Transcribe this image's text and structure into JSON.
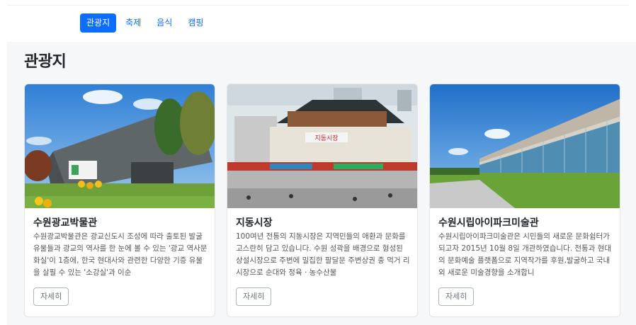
{
  "tabs": [
    {
      "label": "관광지",
      "active": true
    },
    {
      "label": "축제",
      "active": false
    },
    {
      "label": "음식",
      "active": false
    },
    {
      "label": "캠핑",
      "active": false
    }
  ],
  "section_title": "관광지",
  "cards": [
    {
      "name": "수원광교박물관",
      "description": "수원광교박물관은 광교신도시 조성에 따라 출토된 발굴유물들과 광교의 역사를 한 눈에 볼 수 있는 '광교 역사문화실'이 1층에, 한국 현대사와 관련한 다양한 기증 유물을 살필 수 있는 '소강실'과 이순",
      "button": "자세히"
    },
    {
      "name": "지동시장",
      "description": "100여년 전통의 지동시장은 지역민들의 애환과 문화를 고스란히 담고 있습니다. 수원 성곽을 배경으로 형성된 상설시장으로 주변에 밀집한 팔달문 주변상권 중 먹거 리시장으로 순대와 정육 · 농수산물",
      "button": "자세히",
      "image_sign": "지동시장"
    },
    {
      "name": "수원시립아이파크미술관",
      "description": "수원시립아이파크미술관은 시민들의 새로운 문화쉼터가 되고자 2015년 10월 8일 개관하였습니다. 전통과 현대의 문화예술 플랫폼으로 지역작가를 후원,발굴하고 국내외 새로운 미술경향을 소개합니",
      "button": "자세히"
    }
  ],
  "colors": {
    "accent": "#0d6efd",
    "section_bg": "#f6f7f8"
  }
}
